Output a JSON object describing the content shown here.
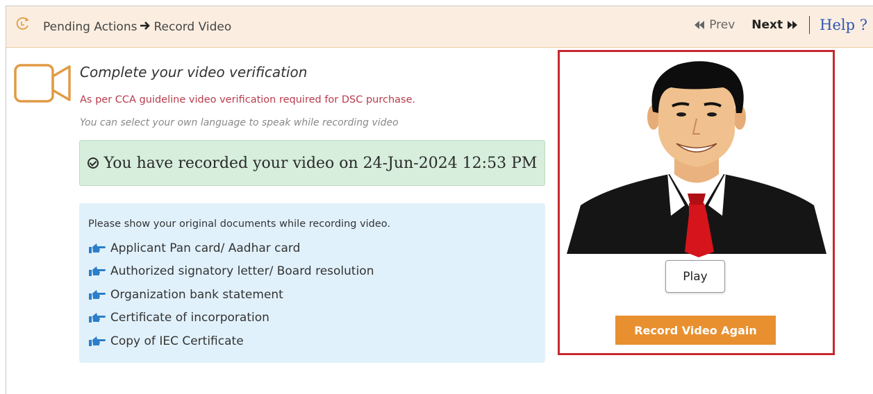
{
  "header": {
    "breadcrumb_pending": "Pending Actions",
    "breadcrumb_current": "Record Video",
    "prev_label": "Prev",
    "next_label": "Next",
    "help_label": "Help ?"
  },
  "main": {
    "title": "Complete your video verification",
    "guideline_text": "As per CCA guideline video verification required for DSC purchase.",
    "language_text": "You can select your own language to speak while recording video",
    "success_message": "You have recorded your video on 24-Jun-2024 12:53 PM",
    "documents_intro": "Please show your original documents while recording video.",
    "documents": [
      "Applicant Pan card/ Aadhar card",
      "Authorized signatory letter/ Board resolution",
      "Organization bank statement",
      "Certificate of incorporation",
      "Copy of IEC Certificate"
    ]
  },
  "video": {
    "play_label": "Play",
    "record_again_label": "Record Video Again"
  },
  "colors": {
    "header_bg": "#fbeee0",
    "accent_orange": "#e8902f",
    "success_bg": "#d6eedb",
    "info_bg": "#e1f1fb",
    "guideline_red": "#b83b4b",
    "panel_border": "#c6282d",
    "help_link": "#2f56b5"
  },
  "icons": [
    "refresh-logo-icon",
    "arrow-right-icon",
    "prev-icon",
    "next-icon",
    "video-camera-icon",
    "check-circle-icon",
    "hand-pointer-icon"
  ]
}
